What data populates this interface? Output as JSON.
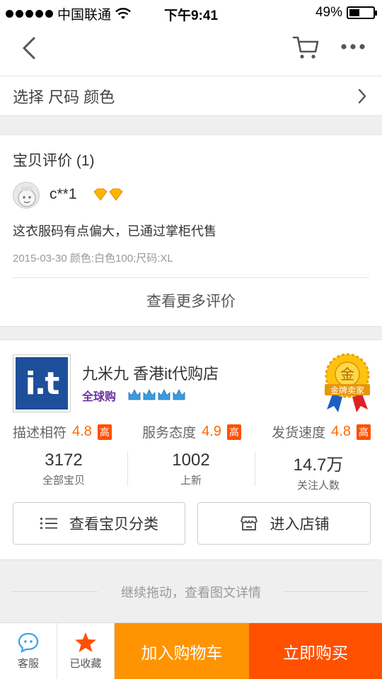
{
  "statusbar": {
    "carrier": "中国联通",
    "time": "下午9:41",
    "battery": "49%",
    "battery_level": 0.49
  },
  "nav": {
    "back_icon": "chevron-left-icon",
    "cart_icon": "cart-icon",
    "more_icon": "more-icon"
  },
  "sku": {
    "label": "选择 尺码 颜色"
  },
  "review": {
    "title": "宝贝评价 (1)",
    "user": "c**1",
    "text": "这衣服码有点偏大，已通过掌柜代售",
    "meta": "2015-03-30 颜色:白色100;尺码:XL",
    "more": "查看更多评价"
  },
  "shop": {
    "logo_text": "i.t",
    "name": "九米九 香港it代购店",
    "global_label": "全球购",
    "badge_char": "金",
    "badge_label": "金牌卖家",
    "scores": [
      {
        "label": "描述相符",
        "value": "4.8",
        "tag": "高"
      },
      {
        "label": "服务态度",
        "value": "4.9",
        "tag": "高"
      },
      {
        "label": "发货速度",
        "value": "4.8",
        "tag": "高"
      }
    ],
    "stats": [
      {
        "value": "3172",
        "label": "全部宝贝"
      },
      {
        "value": "1002",
        "label": "上新"
      },
      {
        "value": "14.7万",
        "label": "关注人数"
      }
    ],
    "btn_category": "查看宝贝分类",
    "btn_enter": "进入店铺"
  },
  "drag_hint": "继续拖动，查看图文详情",
  "bottom": {
    "service": "客服",
    "favorited": "已收藏",
    "add_cart": "加入购物车",
    "buy_now": "立即购买"
  },
  "colors": {
    "orange": "#ff9402",
    "red_orange": "#ff5000",
    "score": "#ff6a00"
  }
}
